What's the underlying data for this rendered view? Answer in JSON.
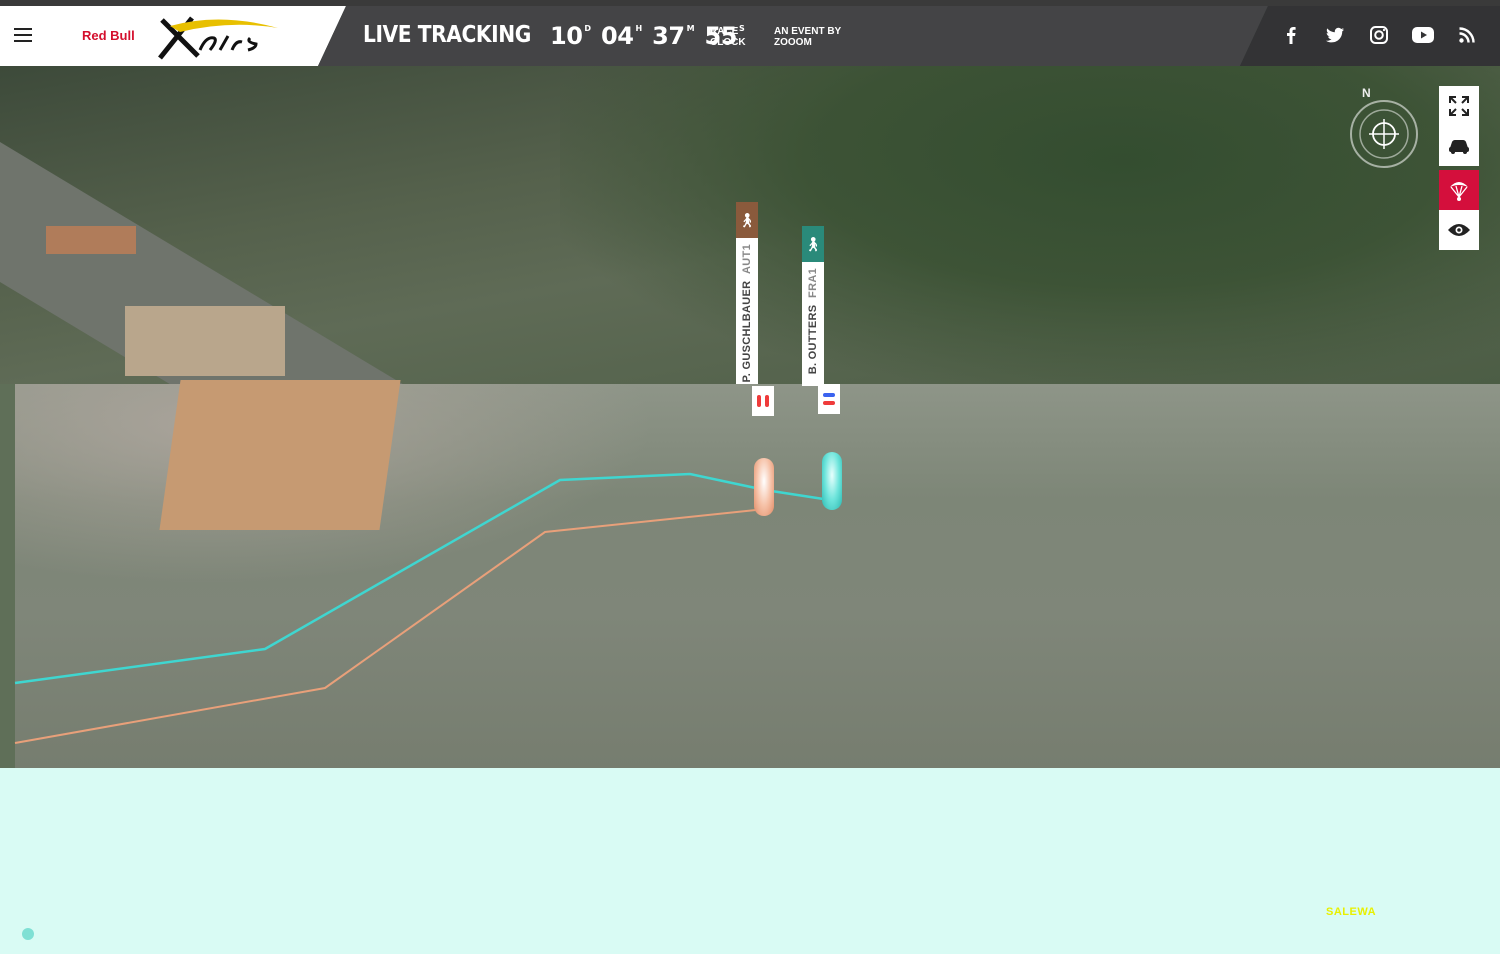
{
  "header": {
    "brand": "Red Bull",
    "title": "LIVE TRACKING",
    "clock": {
      "days": "10",
      "days_unit": "D",
      "hours": "04",
      "hours_unit": "H",
      "minutes": "37",
      "minutes_unit": "M",
      "seconds": "55",
      "seconds_unit": "S",
      "label_line1": "RACE",
      "label_line2": "CLOCK"
    },
    "event_by_line1": "AN EVENT BY",
    "event_by_line2": "ZOOOM",
    "social_icons": [
      "facebook-icon",
      "twitter-icon",
      "instagram-icon",
      "youtube-icon",
      "rss-icon"
    ]
  },
  "pilots": [
    {
      "name": "P. GUSCHLBAUER",
      "code": "AUT1",
      "color": "#8a5a3c",
      "track_color": "#e8a07a"
    },
    {
      "name": "B. OUTTERS",
      "code": "FRA1",
      "color": "#2a8a7a",
      "track_color": "#3fd6d0"
    }
  ],
  "map": {
    "compass_label": "N",
    "controls": [
      "fullscreen-icon",
      "car-view-icon",
      "paraglider-icon",
      "eye-icon"
    ],
    "active_control": "paraglider-icon",
    "sponsor": "SALEWA"
  },
  "colors": {
    "accent": "#d40f3c",
    "header_dark": "#444446"
  }
}
